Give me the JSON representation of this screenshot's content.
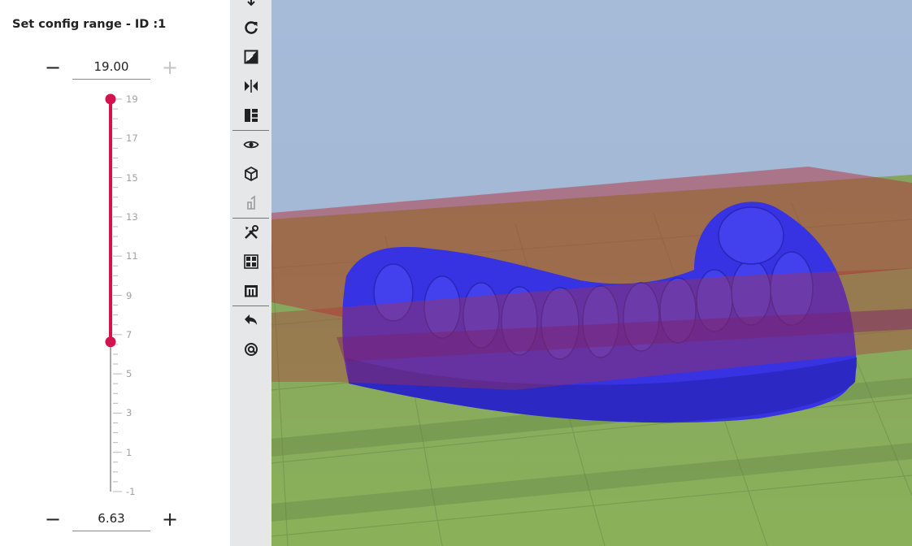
{
  "panel": {
    "title": "Set config range - ID :1",
    "upper": {
      "value": "19.00",
      "minus": "−",
      "plus": "+"
    },
    "lower": {
      "value": "6.63",
      "minus": "−",
      "plus": "+"
    }
  },
  "slider": {
    "min": -1,
    "max": 19,
    "range_low": 6.63,
    "range_high": 19,
    "tick_labels": [
      "19",
      "17",
      "15",
      "13",
      "11",
      "9",
      "7",
      "5",
      "3",
      "1",
      "-1"
    ],
    "accent_color": "#d4124f"
  },
  "toolbar": {
    "buttons": [
      "move-icon",
      "rotate-icon",
      "scale-icon",
      "mirror-icon",
      "layout-icon",
      "eye-icon",
      "cube-icon",
      "support-icon",
      "tools-icon",
      "grid-icon",
      "base-icon",
      "undo-icon",
      "settings-icon"
    ]
  },
  "viewport": {
    "model_color": "#3a34e0",
    "range_plane_color": "#b4323c",
    "floor_color": "#7aa640",
    "sky_color": "#a2b8d6"
  }
}
